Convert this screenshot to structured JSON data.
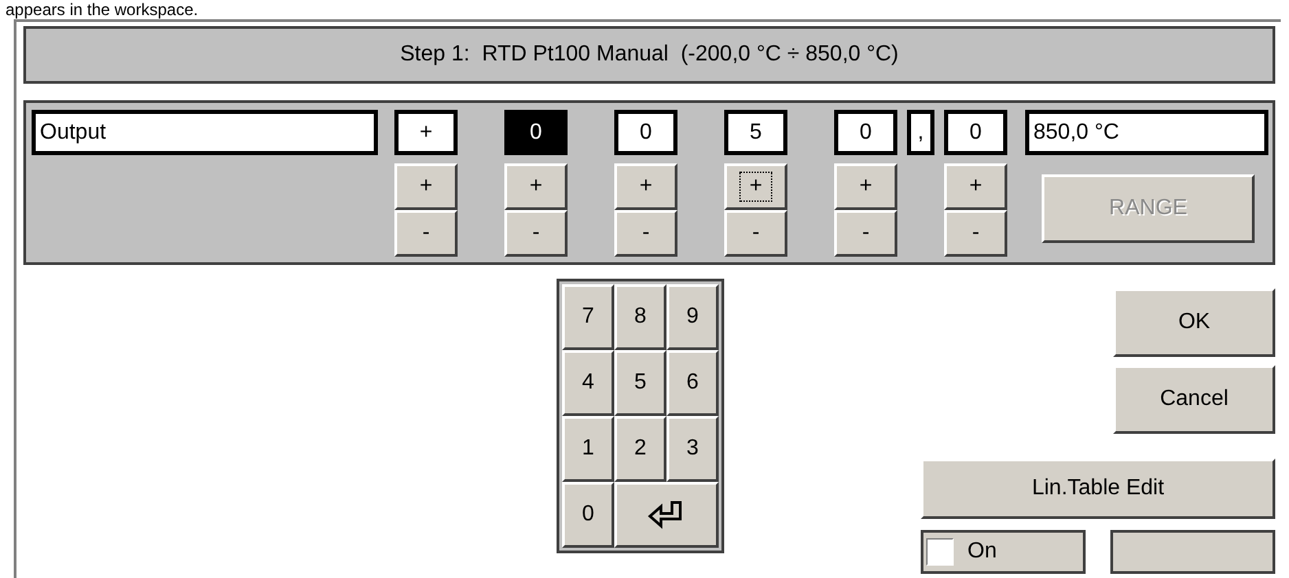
{
  "caption": "appears in the workspace.",
  "title": "Step 1:  RTD Pt100 Manual  (-200,0 °C ÷ 850,0 °C)",
  "output_label": "Output",
  "digits": [
    {
      "kind": "digit",
      "value": "+",
      "selected": false,
      "plus": "+",
      "minus": "-",
      "focused": false
    },
    {
      "kind": "digit",
      "value": "0",
      "selected": true,
      "plus": "+",
      "minus": "-",
      "focused": false
    },
    {
      "kind": "digit",
      "value": "0",
      "selected": false,
      "plus": "+",
      "minus": "-",
      "focused": false
    },
    {
      "kind": "digit",
      "value": "5",
      "selected": false,
      "plus": "+",
      "minus": "-",
      "focused": true
    },
    {
      "kind": "digit",
      "value": "0",
      "selected": false,
      "plus": "+",
      "minus": "-",
      "focused": false
    },
    {
      "kind": "separator",
      "value": ","
    },
    {
      "kind": "digit",
      "value": "0",
      "selected": false,
      "plus": "+",
      "minus": "-",
      "focused": false
    }
  ],
  "value_display": "850,0 °C",
  "range_button": {
    "label": "RANGE",
    "disabled": true
  },
  "keypad": [
    {
      "kind": "digit",
      "label": "7"
    },
    {
      "kind": "digit",
      "label": "8"
    },
    {
      "kind": "digit",
      "label": "9"
    },
    {
      "kind": "digit",
      "label": "4"
    },
    {
      "kind": "digit",
      "label": "5"
    },
    {
      "kind": "digit",
      "label": "6"
    },
    {
      "kind": "digit",
      "label": "1"
    },
    {
      "kind": "digit",
      "label": "2"
    },
    {
      "kind": "digit",
      "label": "3"
    },
    {
      "kind": "digit",
      "label": "0"
    },
    {
      "kind": "enter"
    }
  ],
  "ok_button": {
    "label": "OK"
  },
  "cancel_button": {
    "label": "Cancel"
  },
  "lin_table_button": {
    "label": "Lin.Table Edit"
  },
  "on_checkbox": {
    "label": "On",
    "checked": false
  }
}
